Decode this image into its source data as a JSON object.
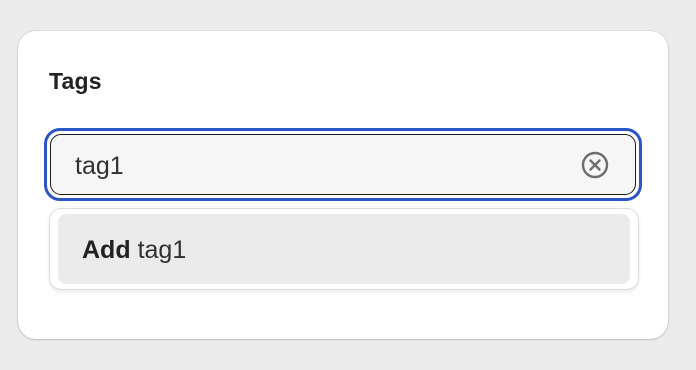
{
  "card": {
    "title": "Tags"
  },
  "tag_input": {
    "value": "tag1",
    "clear_icon": "circle-x-icon",
    "focus_color": "#2a56c6"
  },
  "dropdown": {
    "options": [
      {
        "verb": "Add",
        "value": "tag1"
      }
    ]
  }
}
